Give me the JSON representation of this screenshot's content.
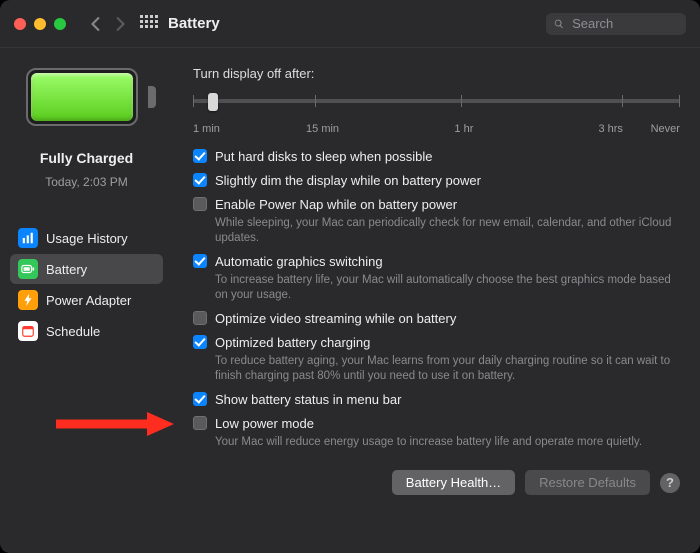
{
  "header": {
    "title": "Battery",
    "search_placeholder": "Search"
  },
  "sidebar": {
    "status_title": "Fully Charged",
    "status_sub": "Today, 2:03 PM",
    "nav": [
      {
        "label": "Usage History",
        "selected": false
      },
      {
        "label": "Battery",
        "selected": true
      },
      {
        "label": "Power Adapter",
        "selected": false
      },
      {
        "label": "Schedule",
        "selected": false
      }
    ]
  },
  "main": {
    "slider_label": "Turn display off after:",
    "slider_ticks": [
      "1 min",
      "15 min",
      "1 hr",
      "3 hrs",
      "Never"
    ],
    "options": [
      {
        "checked": true,
        "title": "Put hard disks to sleep when possible"
      },
      {
        "checked": true,
        "title": "Slightly dim the display while on battery power"
      },
      {
        "checked": false,
        "title": "Enable Power Nap while on battery power",
        "desc": "While sleeping, your Mac can periodically check for new email, calendar, and other iCloud updates."
      },
      {
        "checked": true,
        "title": "Automatic graphics switching",
        "desc": "To increase battery life, your Mac will automatically choose the best graphics mode based on your usage."
      },
      {
        "checked": false,
        "title": "Optimize video streaming while on battery"
      },
      {
        "checked": true,
        "title": "Optimized battery charging",
        "desc": "To reduce battery aging, your Mac learns from your daily charging routine so it can wait to finish charging past 80% until you need to use it on battery."
      },
      {
        "checked": true,
        "title": "Show battery status in menu bar"
      },
      {
        "checked": false,
        "title": "Low power mode",
        "desc": "Your Mac will reduce energy usage to increase battery life and operate more quietly."
      }
    ],
    "footer": {
      "health": "Battery Health…",
      "restore": "Restore Defaults",
      "help": "?"
    }
  }
}
